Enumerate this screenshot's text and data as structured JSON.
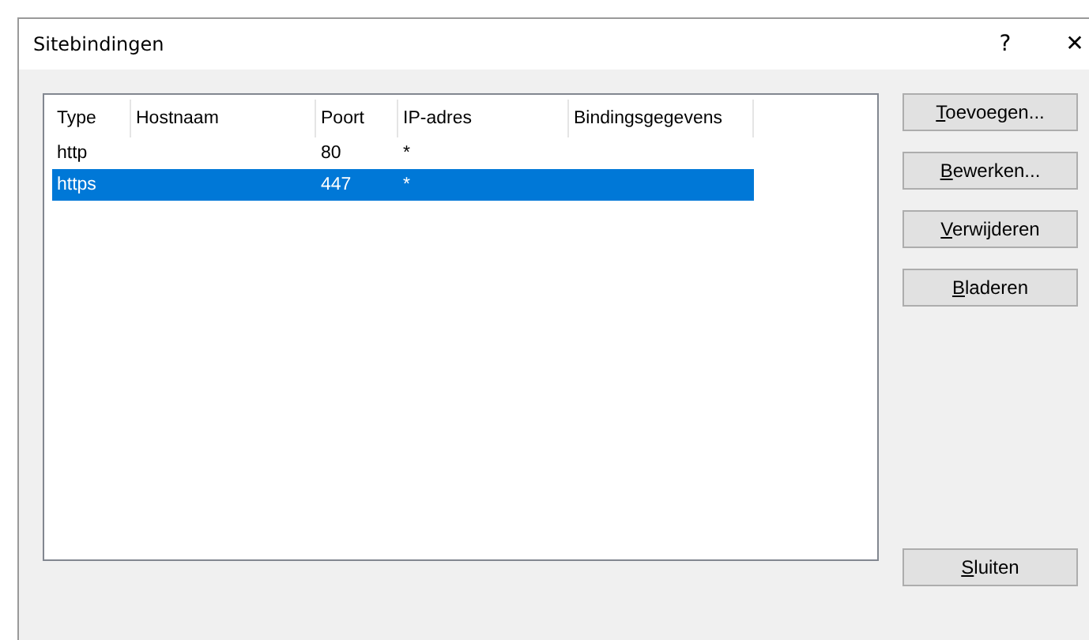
{
  "window": {
    "title": "Sitebindingen",
    "help": "?",
    "close": "✕"
  },
  "table": {
    "columns": [
      "Type",
      "Hostnaam",
      "Poort",
      "IP-adres",
      "Bindingsgegevens"
    ],
    "rows": [
      {
        "cells": [
          "http",
          "",
          "80",
          "*",
          ""
        ],
        "selected": false
      },
      {
        "cells": [
          "https",
          "",
          "447",
          "*",
          ""
        ],
        "selected": true
      }
    ]
  },
  "buttons": [
    "Toevoegen...",
    "Bewerken...",
    "Verwijderen",
    "Bladeren"
  ],
  "close_button": "Sluiten"
}
